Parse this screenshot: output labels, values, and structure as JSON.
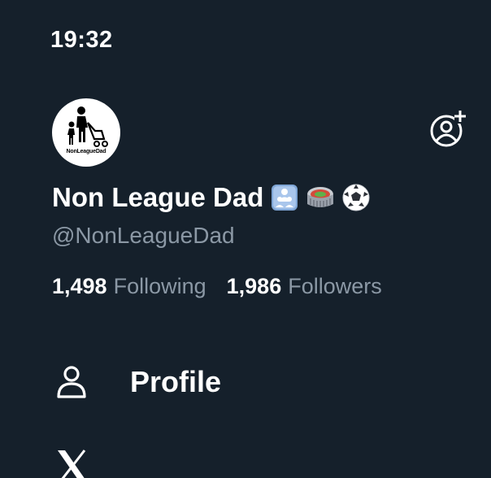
{
  "status_bar": {
    "time": "19:32"
  },
  "profile": {
    "avatar_caption": "NonLeagueDad",
    "display_name": "Non League Dad",
    "name_emojis": [
      "family-icon",
      "stadium-icon",
      "soccer-ball-icon"
    ],
    "handle": "@NonLeagueDad"
  },
  "stats": {
    "following_count": "1,498",
    "following_label": "Following",
    "followers_count": "1,986",
    "followers_label": "Followers"
  },
  "menu": {
    "items": [
      {
        "icon": "person-icon",
        "label": "Profile"
      }
    ],
    "partial_next_icon": "x-logo-icon"
  },
  "colors": {
    "background": "#15202b",
    "text_primary": "#ffffff",
    "text_secondary": "#8b98a5"
  }
}
